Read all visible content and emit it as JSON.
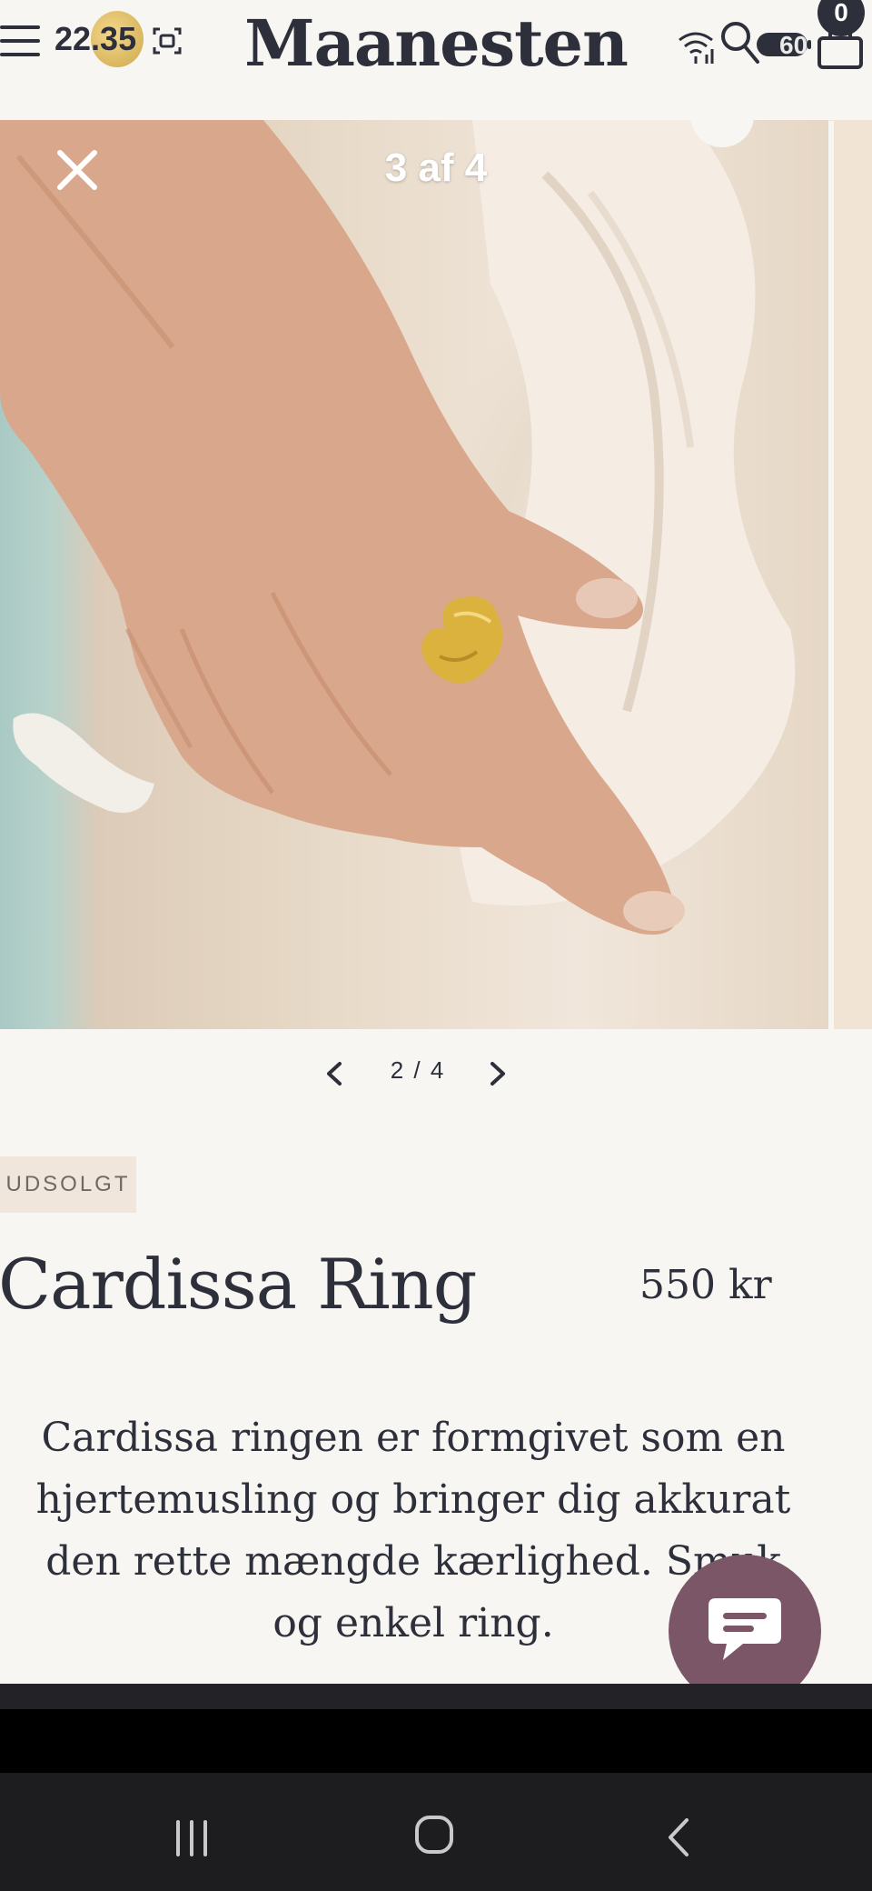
{
  "status": {
    "time": "22.35",
    "battery": "60"
  },
  "header": {
    "brand": "Maanesten",
    "cart_count": "0"
  },
  "viewer": {
    "counter": "3 af 4"
  },
  "pager": {
    "text": "2 / 4"
  },
  "product": {
    "badge": "UDSOLGT",
    "title": "Cardissa Ring",
    "price": "550 kr",
    "description": "Cardissa ringen er formgivet som en hjertemusling og bringer dig akkurat den rette mængde kærlighed. Smuk og enkel ring."
  },
  "icons": {
    "menu": "menu-icon",
    "search": "search-icon",
    "cart": "cart-icon",
    "close": "close-icon",
    "prev": "chevron-left-icon",
    "next": "chevron-right-icon",
    "chat": "chat-icon"
  }
}
